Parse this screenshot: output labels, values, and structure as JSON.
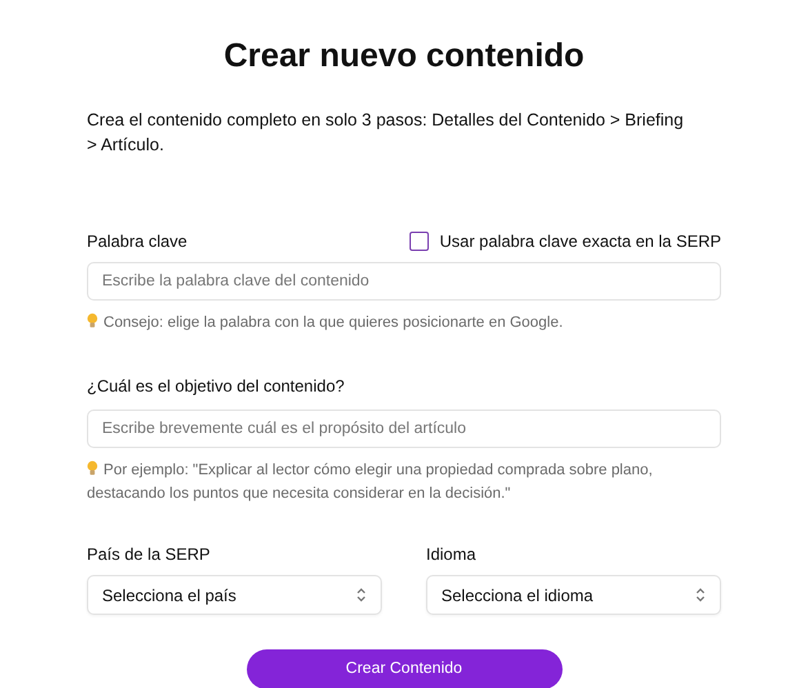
{
  "title": "Crear nuevo contenido",
  "description": "Crea el contenido completo en solo 3 pasos: Detalles del Contenido > Briefing > Artículo.",
  "keyword": {
    "label": "Palabra clave",
    "exact_match": {
      "label": "Usar palabra clave exacta en la SERP",
      "checked": false
    },
    "placeholder": "Escribe la palabra clave del contenido",
    "hint": "Consejo: elige la palabra con la que quieres posicionarte en Google."
  },
  "objective": {
    "label": "¿Cuál es el objetivo del contenido?",
    "placeholder": "Escribe brevemente cuál es el propósito del artículo",
    "hint": "Por ejemplo: \"Explicar al lector cómo elegir una propiedad comprada sobre plano, destacando los puntos que necesita considerar en la decisión.\""
  },
  "selects": [
    {
      "label": "País de la SERP",
      "value": "Selecciona el país"
    },
    {
      "label": "Idioma",
      "value": "Selecciona el idioma"
    }
  ],
  "submit": "Crear Contenido"
}
